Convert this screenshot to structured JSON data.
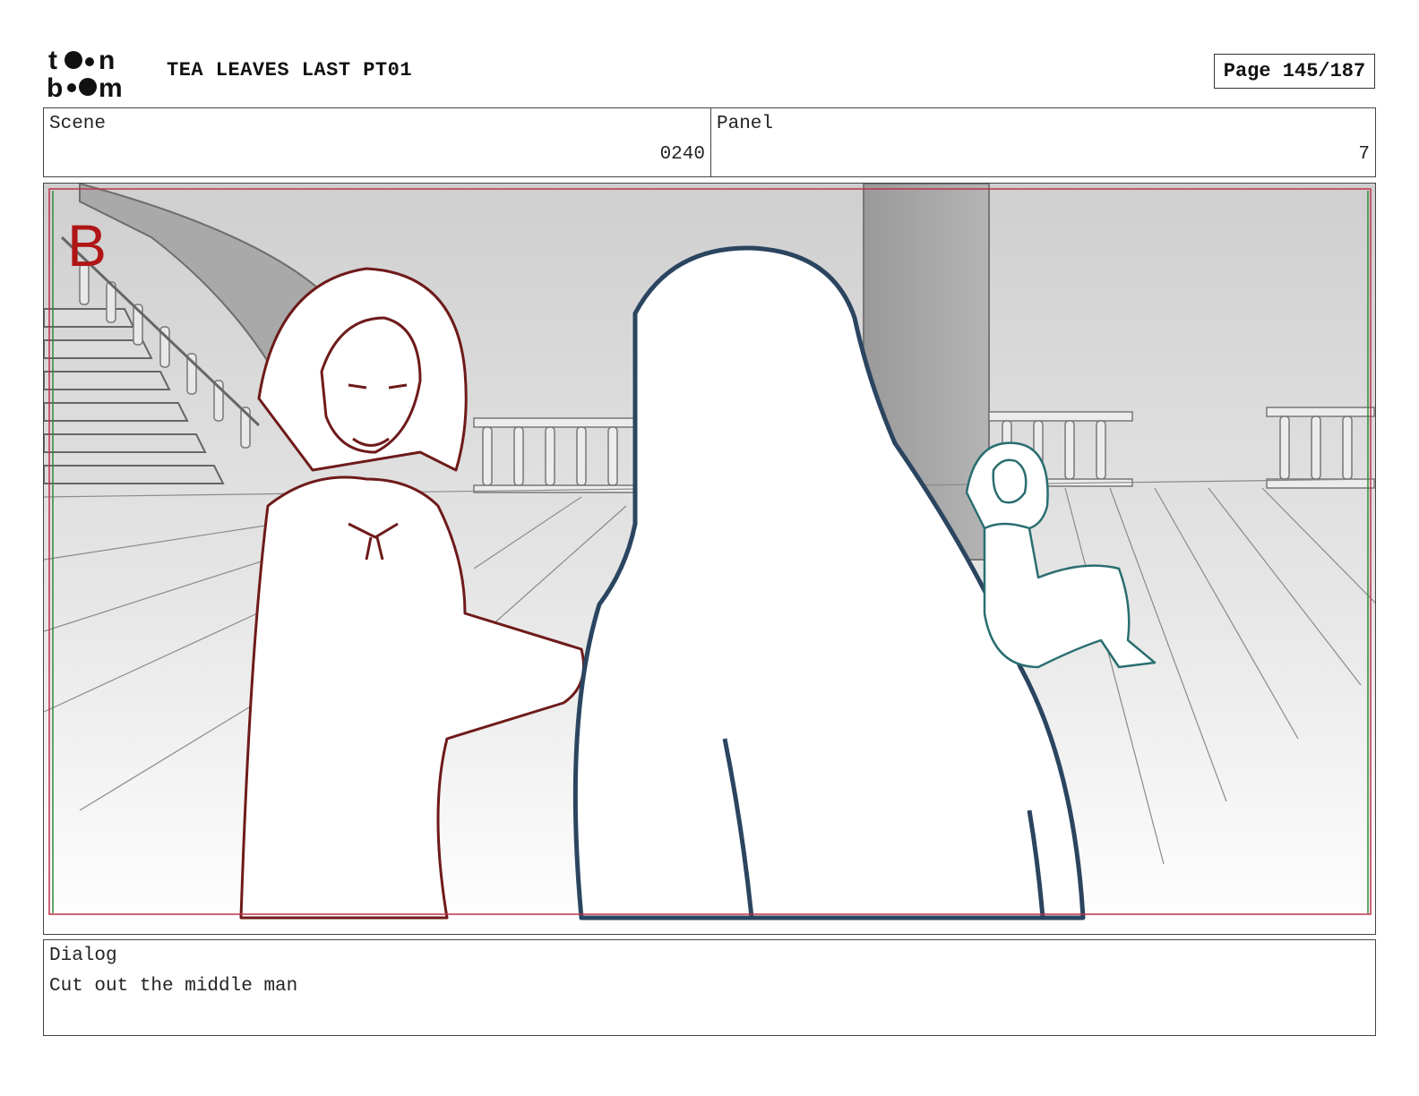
{
  "header": {
    "logo_text": "toon boom",
    "title": "TEA LEAVES LAST PT01",
    "page": "Page 145/187"
  },
  "scene": {
    "label": "Scene",
    "value": "0240"
  },
  "panel": {
    "label": "Panel",
    "value": "7"
  },
  "frame": {
    "marker": "B",
    "marker_color": "#b01515",
    "character_left_color": "#6e1a1a",
    "character_center_color": "#2b4560",
    "character_right_color": "#2a6e70"
  },
  "dialog": {
    "label": "Dialog",
    "text": "Cut out the middle man"
  }
}
